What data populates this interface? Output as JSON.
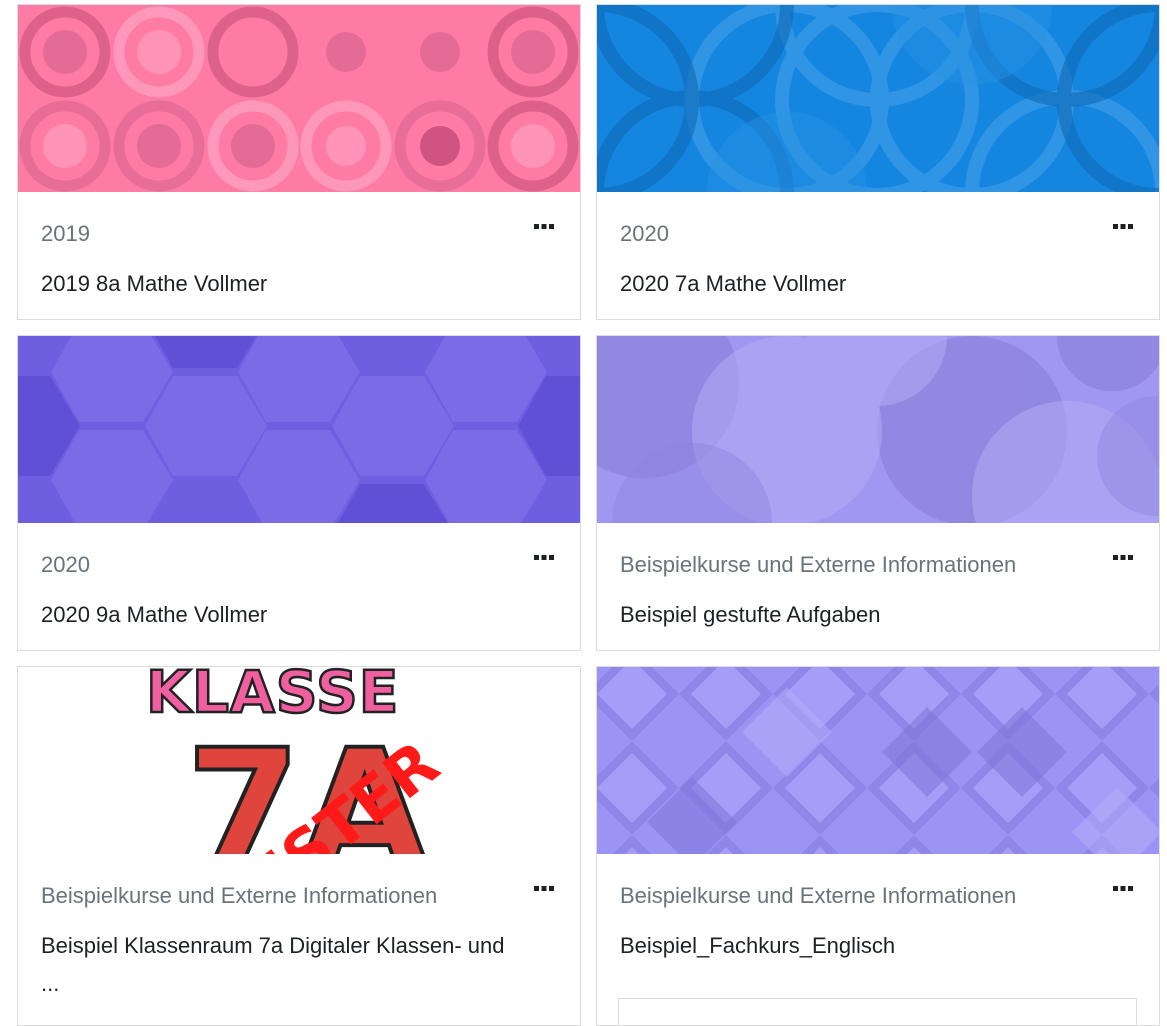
{
  "courses": [
    {
      "category": "2019",
      "title": "2019 8a Mathe Vollmer",
      "image": "pink-circles-pattern",
      "menu": "more-options"
    },
    {
      "category": "2020",
      "title": "2020 7a Mathe Vollmer",
      "image": "blue-circles-pattern",
      "menu": "more-options"
    },
    {
      "category": "2020",
      "title": "2020 9a Mathe Vollmer",
      "image": "purple-hexagon-pattern",
      "menu": "more-options"
    },
    {
      "category": "Beispielkurse und Externe Informationen",
      "title": "Beispiel gestufte Aufgaben",
      "image": "lavender-circles-pattern",
      "menu": "more-options"
    },
    {
      "category": "Beispielkurse und Externe Informationen",
      "title": "Beispiel Klassenraum 7a Digitaler Klassen- und ...",
      "image": "klasse-7a-muster-drawing",
      "menu": "more-options"
    },
    {
      "category": "Beispielkurse und Externe Informationen",
      "title": "Beispiel_Fachkurs_Englisch",
      "image": "violet-diamonds-pattern",
      "menu": "more-options"
    }
  ],
  "image_text": {
    "klasse": "KLASSE",
    "seven_a": "7A",
    "muster": "MUSTER"
  },
  "colors": {
    "pink": "#fe7ba6",
    "blue": "#1586e0",
    "purple": "#6e5ee0",
    "lavender": "#a097f0",
    "violet": "#9c94f4",
    "text": "#1d2125",
    "muted": "#6a737b",
    "border": "#dcdcdc"
  }
}
